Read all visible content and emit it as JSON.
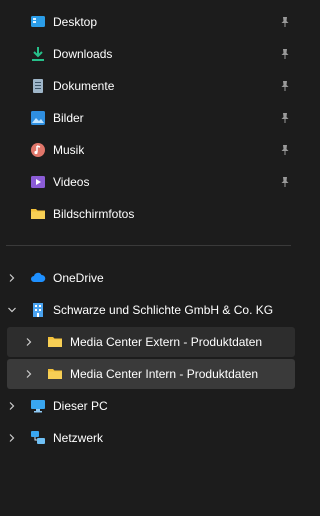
{
  "quick_access": [
    {
      "label": "Desktop",
      "icon": "desktop-icon",
      "pinned": true
    },
    {
      "label": "Downloads",
      "icon": "downloads-icon",
      "pinned": true
    },
    {
      "label": "Dokumente",
      "icon": "documents-icon",
      "pinned": true
    },
    {
      "label": "Bilder",
      "icon": "pictures-icon",
      "pinned": true
    },
    {
      "label": "Musik",
      "icon": "music-icon",
      "pinned": true
    },
    {
      "label": "Videos",
      "icon": "videos-icon",
      "pinned": true
    },
    {
      "label": "Bildschirmfotos",
      "icon": "folder-icon",
      "pinned": false
    }
  ],
  "tree": {
    "onedrive": {
      "label": "OneDrive",
      "icon": "cloud-icon"
    },
    "company": {
      "label": "Schwarze und Schlichte GmbH & Co. KG",
      "icon": "building-icon"
    },
    "subfolders": [
      {
        "label": "Media Center Extern - Produktdaten",
        "icon": "folder-icon"
      },
      {
        "label": "Media Center Intern - Produktdaten",
        "icon": "folder-icon"
      }
    ],
    "this_pc": {
      "label": "Dieser PC",
      "icon": "monitor-icon"
    },
    "network": {
      "label": "Netzwerk",
      "icon": "network-icon"
    }
  },
  "colors": {
    "background": "#1c1c1c",
    "hover_row": "#2d2d2d",
    "selected_row": "#3a3a3a",
    "folder_yellow": "#f3c13a",
    "onedrive_blue": "#1e90ff"
  }
}
